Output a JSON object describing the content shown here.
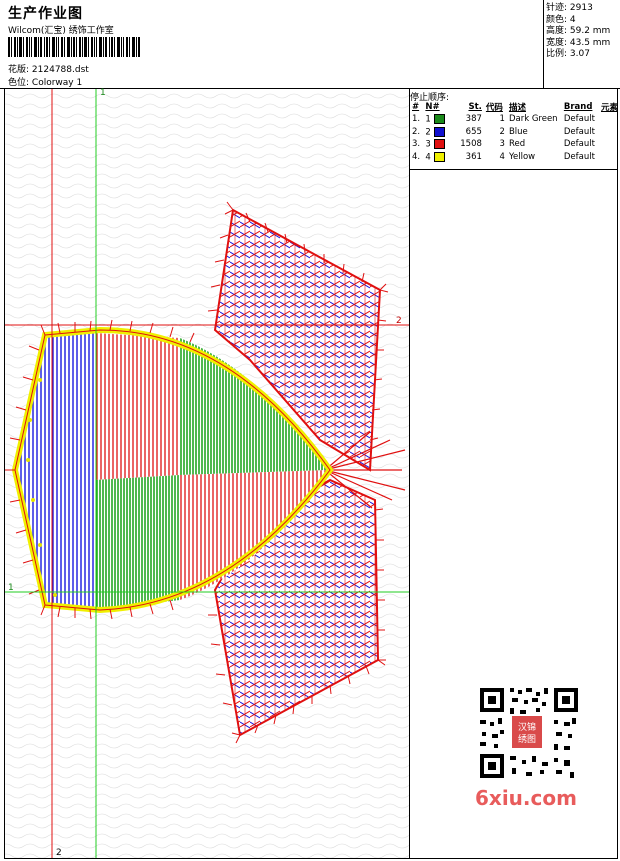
{
  "header": {
    "title": "生产作业图",
    "subtitle": "Wilcom(汇宝) 绣饰工作室",
    "design_label": "花版:",
    "design_value": "2124788.dst",
    "colorway_label": "色位:",
    "colorway_value": "Colorway 1"
  },
  "stats": {
    "stitches": "针迹: 2913",
    "colors": "颜色: 4",
    "height": "高度: 59.2 mm",
    "width": "宽度: 43.5 mm",
    "scale": "比例: 3.07"
  },
  "stops": {
    "heading": "停止顺序:",
    "columns": [
      "#",
      "N#",
      "St.",
      "代码",
      "描述",
      "Brand",
      "元素"
    ],
    "rows": [
      {
        "idx": "1.",
        "n": "1",
        "color": "#1a8a1a",
        "st": "387",
        "code": "1",
        "desc": "Dark Green",
        "brand": "Default"
      },
      {
        "idx": "2.",
        "n": "2",
        "color": "#1010d0",
        "st": "655",
        "code": "2",
        "desc": "Blue",
        "brand": "Default"
      },
      {
        "idx": "3.",
        "n": "3",
        "color": "#e01010",
        "st": "1508",
        "code": "3",
        "desc": "Red",
        "brand": "Default"
      },
      {
        "idx": "4.",
        "n": "4",
        "color": "#f0f000",
        "st": "361",
        "code": "4",
        "desc": "Yellow",
        "brand": "Default"
      }
    ]
  },
  "guides": {
    "v1": "1",
    "v2": "2",
    "h1": "1",
    "h2": "2"
  },
  "watermark": "6xiu.com",
  "qr_stamp": "汉锦绣图"
}
